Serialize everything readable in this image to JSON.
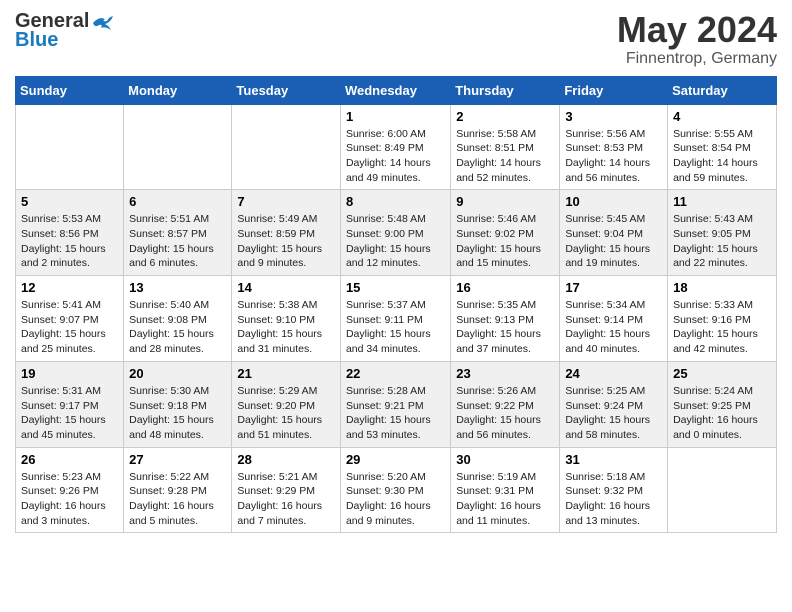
{
  "header": {
    "logo_general": "General",
    "logo_blue": "Blue",
    "month": "May 2024",
    "location": "Finnentrop, Germany"
  },
  "days_of_week": [
    "Sunday",
    "Monday",
    "Tuesday",
    "Wednesday",
    "Thursday",
    "Friday",
    "Saturday"
  ],
  "weeks": [
    [
      {
        "day": "",
        "info": ""
      },
      {
        "day": "",
        "info": ""
      },
      {
        "day": "",
        "info": ""
      },
      {
        "day": "1",
        "info": "Sunrise: 6:00 AM\nSunset: 8:49 PM\nDaylight: 14 hours\nand 49 minutes."
      },
      {
        "day": "2",
        "info": "Sunrise: 5:58 AM\nSunset: 8:51 PM\nDaylight: 14 hours\nand 52 minutes."
      },
      {
        "day": "3",
        "info": "Sunrise: 5:56 AM\nSunset: 8:53 PM\nDaylight: 14 hours\nand 56 minutes."
      },
      {
        "day": "4",
        "info": "Sunrise: 5:55 AM\nSunset: 8:54 PM\nDaylight: 14 hours\nand 59 minutes."
      }
    ],
    [
      {
        "day": "5",
        "info": "Sunrise: 5:53 AM\nSunset: 8:56 PM\nDaylight: 15 hours\nand 2 minutes."
      },
      {
        "day": "6",
        "info": "Sunrise: 5:51 AM\nSunset: 8:57 PM\nDaylight: 15 hours\nand 6 minutes."
      },
      {
        "day": "7",
        "info": "Sunrise: 5:49 AM\nSunset: 8:59 PM\nDaylight: 15 hours\nand 9 minutes."
      },
      {
        "day": "8",
        "info": "Sunrise: 5:48 AM\nSunset: 9:00 PM\nDaylight: 15 hours\nand 12 minutes."
      },
      {
        "day": "9",
        "info": "Sunrise: 5:46 AM\nSunset: 9:02 PM\nDaylight: 15 hours\nand 15 minutes."
      },
      {
        "day": "10",
        "info": "Sunrise: 5:45 AM\nSunset: 9:04 PM\nDaylight: 15 hours\nand 19 minutes."
      },
      {
        "day": "11",
        "info": "Sunrise: 5:43 AM\nSunset: 9:05 PM\nDaylight: 15 hours\nand 22 minutes."
      }
    ],
    [
      {
        "day": "12",
        "info": "Sunrise: 5:41 AM\nSunset: 9:07 PM\nDaylight: 15 hours\nand 25 minutes."
      },
      {
        "day": "13",
        "info": "Sunrise: 5:40 AM\nSunset: 9:08 PM\nDaylight: 15 hours\nand 28 minutes."
      },
      {
        "day": "14",
        "info": "Sunrise: 5:38 AM\nSunset: 9:10 PM\nDaylight: 15 hours\nand 31 minutes."
      },
      {
        "day": "15",
        "info": "Sunrise: 5:37 AM\nSunset: 9:11 PM\nDaylight: 15 hours\nand 34 minutes."
      },
      {
        "day": "16",
        "info": "Sunrise: 5:35 AM\nSunset: 9:13 PM\nDaylight: 15 hours\nand 37 minutes."
      },
      {
        "day": "17",
        "info": "Sunrise: 5:34 AM\nSunset: 9:14 PM\nDaylight: 15 hours\nand 40 minutes."
      },
      {
        "day": "18",
        "info": "Sunrise: 5:33 AM\nSunset: 9:16 PM\nDaylight: 15 hours\nand 42 minutes."
      }
    ],
    [
      {
        "day": "19",
        "info": "Sunrise: 5:31 AM\nSunset: 9:17 PM\nDaylight: 15 hours\nand 45 minutes."
      },
      {
        "day": "20",
        "info": "Sunrise: 5:30 AM\nSunset: 9:18 PM\nDaylight: 15 hours\nand 48 minutes."
      },
      {
        "day": "21",
        "info": "Sunrise: 5:29 AM\nSunset: 9:20 PM\nDaylight: 15 hours\nand 51 minutes."
      },
      {
        "day": "22",
        "info": "Sunrise: 5:28 AM\nSunset: 9:21 PM\nDaylight: 15 hours\nand 53 minutes."
      },
      {
        "day": "23",
        "info": "Sunrise: 5:26 AM\nSunset: 9:22 PM\nDaylight: 15 hours\nand 56 minutes."
      },
      {
        "day": "24",
        "info": "Sunrise: 5:25 AM\nSunset: 9:24 PM\nDaylight: 15 hours\nand 58 minutes."
      },
      {
        "day": "25",
        "info": "Sunrise: 5:24 AM\nSunset: 9:25 PM\nDaylight: 16 hours\nand 0 minutes."
      }
    ],
    [
      {
        "day": "26",
        "info": "Sunrise: 5:23 AM\nSunset: 9:26 PM\nDaylight: 16 hours\nand 3 minutes."
      },
      {
        "day": "27",
        "info": "Sunrise: 5:22 AM\nSunset: 9:28 PM\nDaylight: 16 hours\nand 5 minutes."
      },
      {
        "day": "28",
        "info": "Sunrise: 5:21 AM\nSunset: 9:29 PM\nDaylight: 16 hours\nand 7 minutes."
      },
      {
        "day": "29",
        "info": "Sunrise: 5:20 AM\nSunset: 9:30 PM\nDaylight: 16 hours\nand 9 minutes."
      },
      {
        "day": "30",
        "info": "Sunrise: 5:19 AM\nSunset: 9:31 PM\nDaylight: 16 hours\nand 11 minutes."
      },
      {
        "day": "31",
        "info": "Sunrise: 5:18 AM\nSunset: 9:32 PM\nDaylight: 16 hours\nand 13 minutes."
      },
      {
        "day": "",
        "info": ""
      }
    ]
  ]
}
